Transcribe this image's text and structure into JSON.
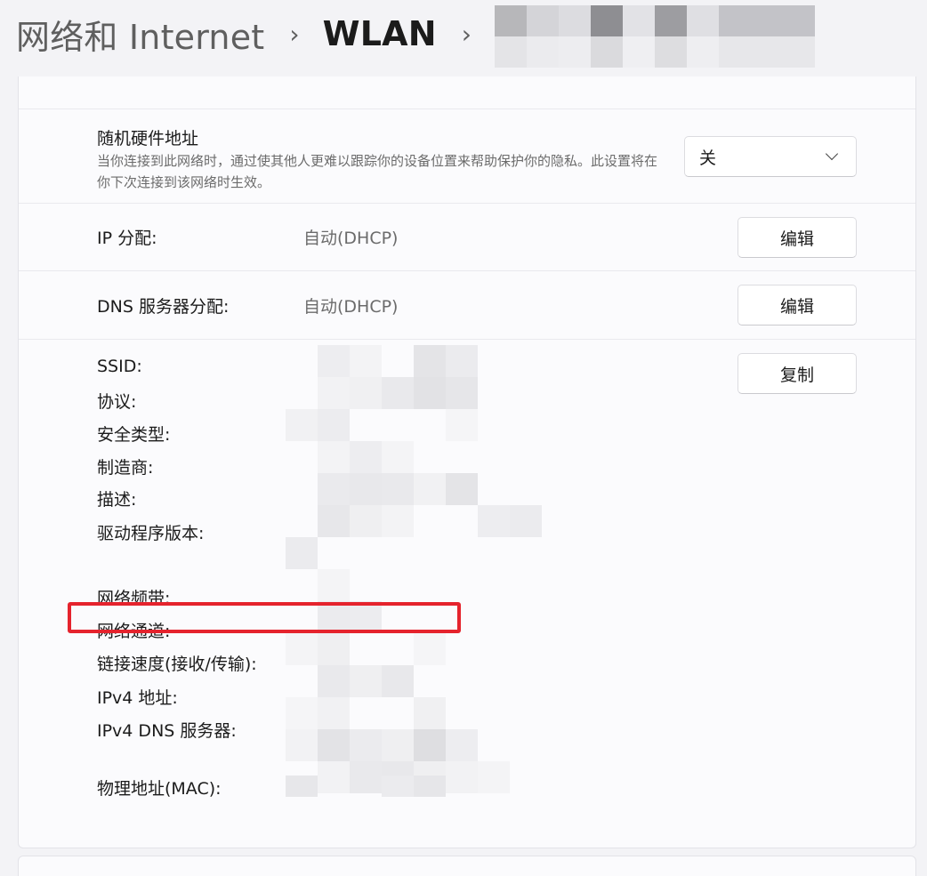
{
  "breadcrumb": {
    "items": [
      "网络和 Internet",
      "WLAN"
    ],
    "separator": "›"
  },
  "random_hardware": {
    "title": "随机硬件地址",
    "description": "当你连接到此网络时，通过使其他人更难以跟踪你的设备位置来帮助保护你的隐私。此设置将在你下次连接到该网络时生效。",
    "selected": "关"
  },
  "ip_assignment": {
    "label": "IP 分配:",
    "value": "自动(DHCP)",
    "button": "编辑"
  },
  "dns_assignment": {
    "label": "DNS 服务器分配:",
    "value": "自动(DHCP)",
    "button": "编辑"
  },
  "properties": {
    "copy_button": "复制",
    "labels": {
      "ssid": "SSID:",
      "protocol": "协议:",
      "security": "安全类型:",
      "manufacturer": "制造商:",
      "description": "描述:",
      "driver": "驱动程序版本:",
      "band": "网络频带:",
      "channel": "网络通道:",
      "speed": "链接速度(接收/传输):",
      "ipv4": "IPv4 地址:",
      "ipv4dns": "IPv4 DNS 服务器:",
      "mac": "物理地址(MAC):"
    }
  },
  "colors": {
    "highlight": "#e5232d",
    "card": "#fbfbfd"
  }
}
